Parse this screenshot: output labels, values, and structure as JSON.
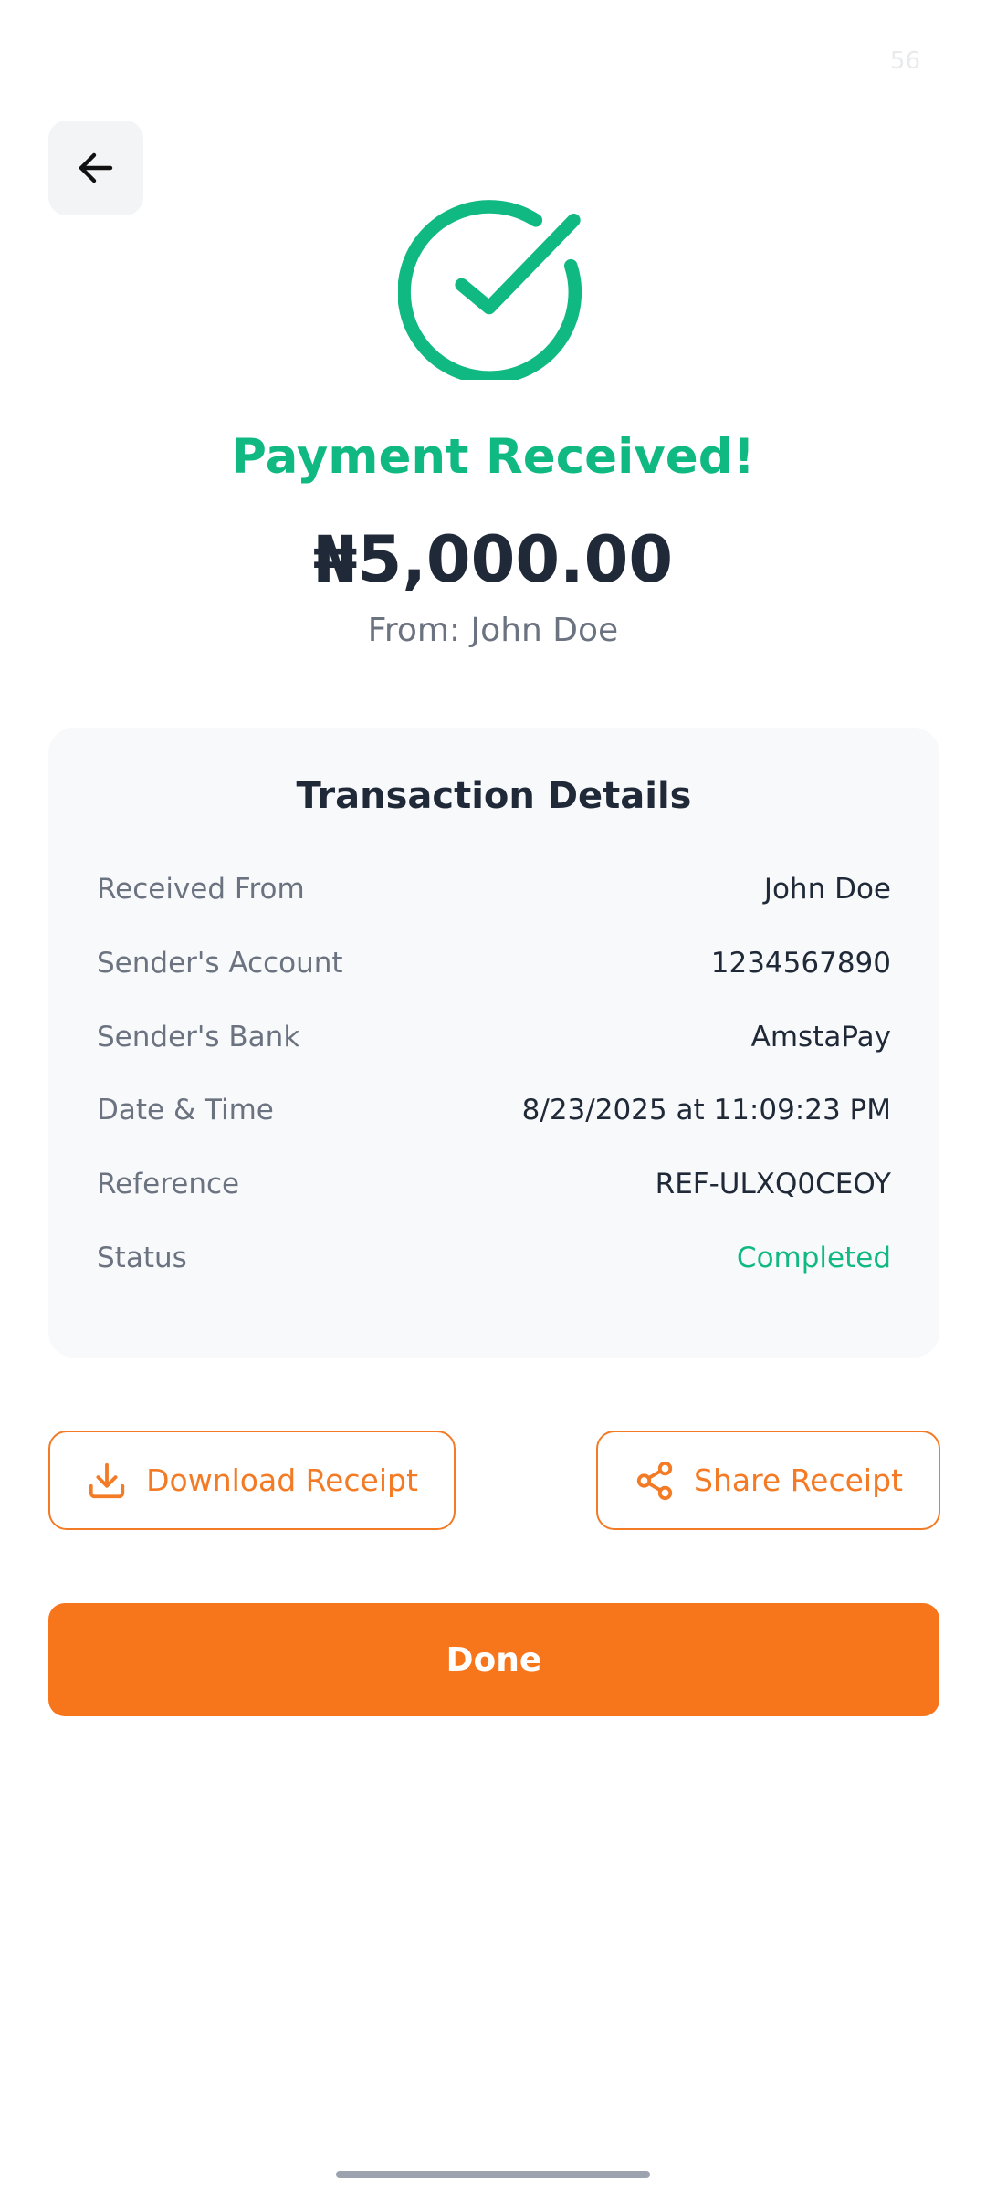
{
  "status_bar": {
    "time": "56"
  },
  "header": {
    "back_icon": "arrow-left-icon"
  },
  "success": {
    "icon": "check-circle-icon",
    "title": "Payment Received!",
    "amount": "₦5,000.00",
    "from_line": "From: John Doe"
  },
  "details": {
    "title": "Transaction Details",
    "rows": [
      {
        "label": "Received From",
        "value": "John Doe"
      },
      {
        "label": "Sender's Account",
        "value": "1234567890"
      },
      {
        "label": "Sender's Bank",
        "value": "AmstaPay"
      },
      {
        "label": "Date & Time",
        "value": "8/23/2025 at 11:09:23 PM"
      },
      {
        "label": "Reference",
        "value": "REF-ULXQ0CEOY"
      },
      {
        "label": "Status",
        "value": "Completed"
      }
    ]
  },
  "actions": {
    "download_label": "Download Receipt",
    "download_icon": "download-icon",
    "share_label": "Share Receipt",
    "share_icon": "share-icon",
    "done_label": "Done"
  },
  "colors": {
    "success_green": "#10b981",
    "accent_orange": "#f47b26",
    "text_dark": "#1f2937",
    "text_muted": "#6b7280",
    "card_bg": "#f8f9fb"
  }
}
